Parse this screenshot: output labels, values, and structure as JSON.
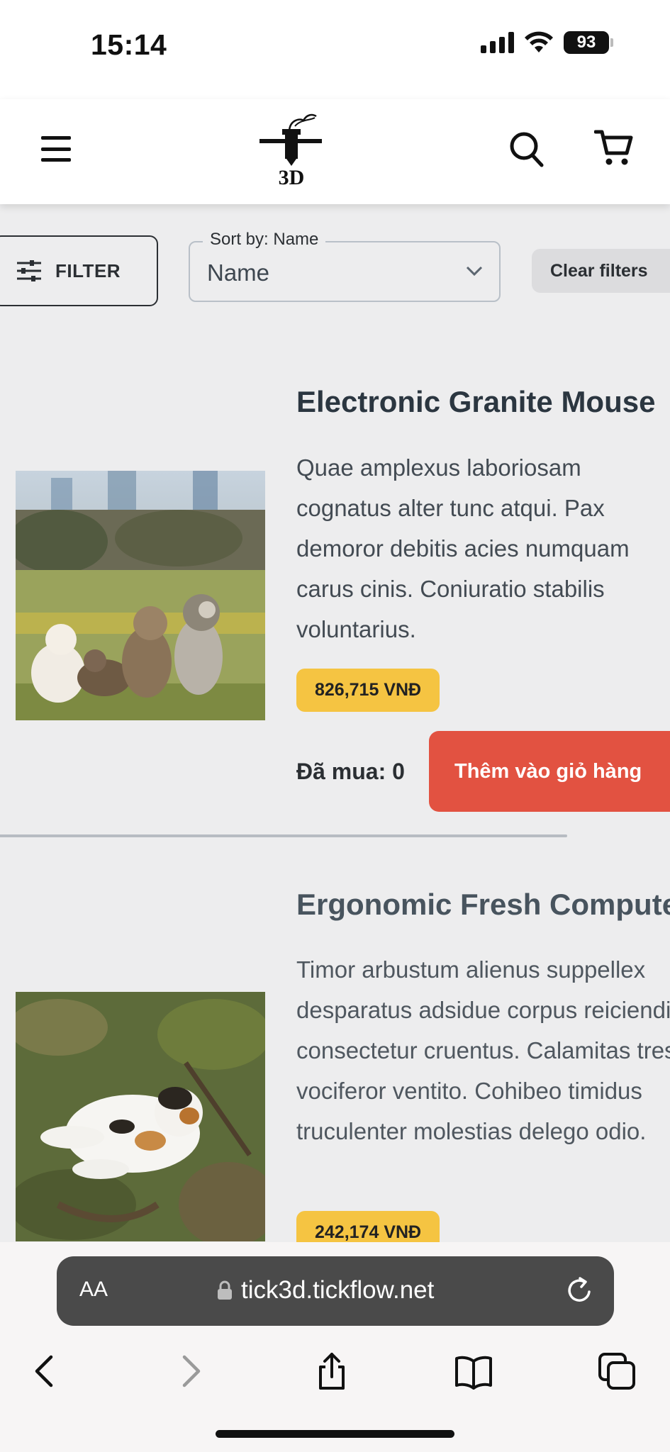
{
  "status_bar": {
    "time": "15:14",
    "battery": "93",
    "icons": [
      "signal-icon",
      "wifi-icon",
      "battery-icon"
    ]
  },
  "header": {
    "menu_icon": "hamburger-menu-icon",
    "logo_text": "3D",
    "search_icon": "search-icon",
    "cart_icon": "cart-icon"
  },
  "filters": {
    "filter_label": "FILTER",
    "sort_legend": "Sort by: Name",
    "sort_value": "Name",
    "clear_label": "Clear filters"
  },
  "products": [
    {
      "title": "Electronic Granite Mouse",
      "description": "Quae amplexus laboriosam cognatus alter tunc atqui. Pax demoror debitis acies numquam carus cinis. Coniuratio stabilis voluntarius.",
      "price": "826,715 VNĐ",
      "purchased": "Đã mua: 0",
      "add_to_cart": "Thêm vào giỏ hàng",
      "image": "cats-in-meadow-photo"
    },
    {
      "title": "Ergonomic Fresh Computer",
      "description": "Timor arbustum alienus suppellex desparatus adsidue corpus reiciendis consectetur cruentus. Calamitas tres vociferor ventito. Cohibeo timidus truculenter molestias delego odio.",
      "price": "242,174 VNĐ",
      "image": "calico-cat-on-grass-photo"
    }
  ],
  "browser": {
    "aa_label": "AA",
    "url": "tick3d.tickflow.net",
    "nav_icons": [
      "back-icon",
      "forward-icon",
      "share-icon",
      "bookmarks-icon",
      "tabs-icon"
    ]
  },
  "colors": {
    "accent_red": "#e25241",
    "price_yellow": "#f5c442",
    "background": "#ededee"
  }
}
